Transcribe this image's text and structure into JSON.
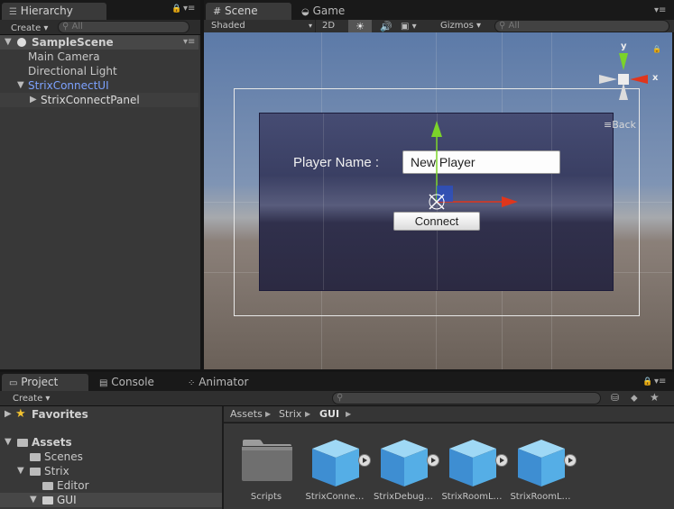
{
  "hierarchy": {
    "tab_label": "Hierarchy",
    "create_label": "Create",
    "search_placeholder": "All",
    "scene_name": "SampleScene",
    "items": [
      {
        "label": "Main Camera"
      },
      {
        "label": "Directional Light"
      },
      {
        "label": "StrixConnectUI"
      },
      {
        "label": "StrixConnectPanel"
      }
    ]
  },
  "scene_view": {
    "tabs": [
      {
        "label": "Scene"
      },
      {
        "label": "Game"
      }
    ],
    "shading_mode": "Shaded",
    "mode_2d": "2D",
    "gizmos_label": "Gizmos",
    "search_placeholder": "All",
    "gizmo_axes": {
      "y": "y",
      "x": "x"
    },
    "back_label": "Back",
    "panel": {
      "player_name_label": "Player Name :",
      "player_name_value": "New Player",
      "connect_label": "Connect"
    }
  },
  "project": {
    "tabs": [
      {
        "label": "Project"
      },
      {
        "label": "Console"
      },
      {
        "label": "Animator"
      }
    ],
    "create_label": "Create",
    "favorites_label": "Favorites",
    "tree": [
      {
        "label": "Assets"
      },
      {
        "label": "Scenes"
      },
      {
        "label": "Strix"
      },
      {
        "label": "Editor"
      },
      {
        "label": "GUI"
      }
    ],
    "breadcrumb": [
      "Assets",
      "Strix",
      "GUI"
    ],
    "assets": [
      {
        "label": "Scripts",
        "type": "folder"
      },
      {
        "label": "StrixConne…",
        "type": "prefab"
      },
      {
        "label": "StrixDebug…",
        "type": "prefab"
      },
      {
        "label": "StrixRoomL…",
        "type": "prefab"
      },
      {
        "label": "StrixRoomL…",
        "type": "prefab"
      }
    ]
  },
  "colors": {
    "selected_blue": "#7da2ff",
    "axis_green": "#7bd32a",
    "axis_red": "#e0361c",
    "cube_blue": "#4da6e0"
  }
}
